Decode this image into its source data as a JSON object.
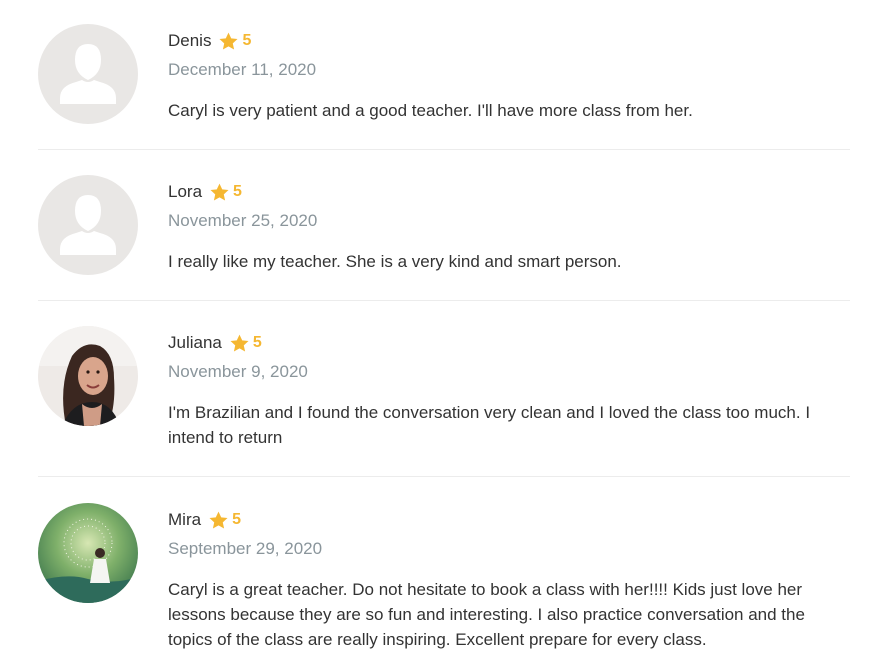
{
  "reviews": [
    {
      "name": "Denis",
      "rating": "5",
      "date": "December 11, 2020",
      "text": "Caryl is very patient and a good teacher. I'll have more class from her.",
      "avatar": "default-user-icon"
    },
    {
      "name": "Lora",
      "rating": "5",
      "date": "November 25, 2020",
      "text": "I really like my teacher. She is a very kind and smart person.",
      "avatar": "default-user-icon"
    },
    {
      "name": "Juliana",
      "rating": "5",
      "date": "November 9, 2020",
      "text": "I'm Brazilian and I found the conversation very clean and I loved the class too much. I intend to return",
      "avatar": "photo"
    },
    {
      "name": "Mira",
      "rating": "5",
      "date": "September 29, 2020",
      "text": "Caryl is a great teacher. Do not hesitate to book a class with her!!!! Kids just love her lessons because they are so fun and interesting. I also practice conversation and the topics of the class are really inspiring. Excellent prepare for every class.",
      "avatar": "painting"
    }
  ],
  "colors": {
    "star": "#f5b731",
    "name_text": "#333333",
    "date_text": "#8a959b",
    "placeholder_bg": "#e9e7e5",
    "divider": "#ececec"
  }
}
